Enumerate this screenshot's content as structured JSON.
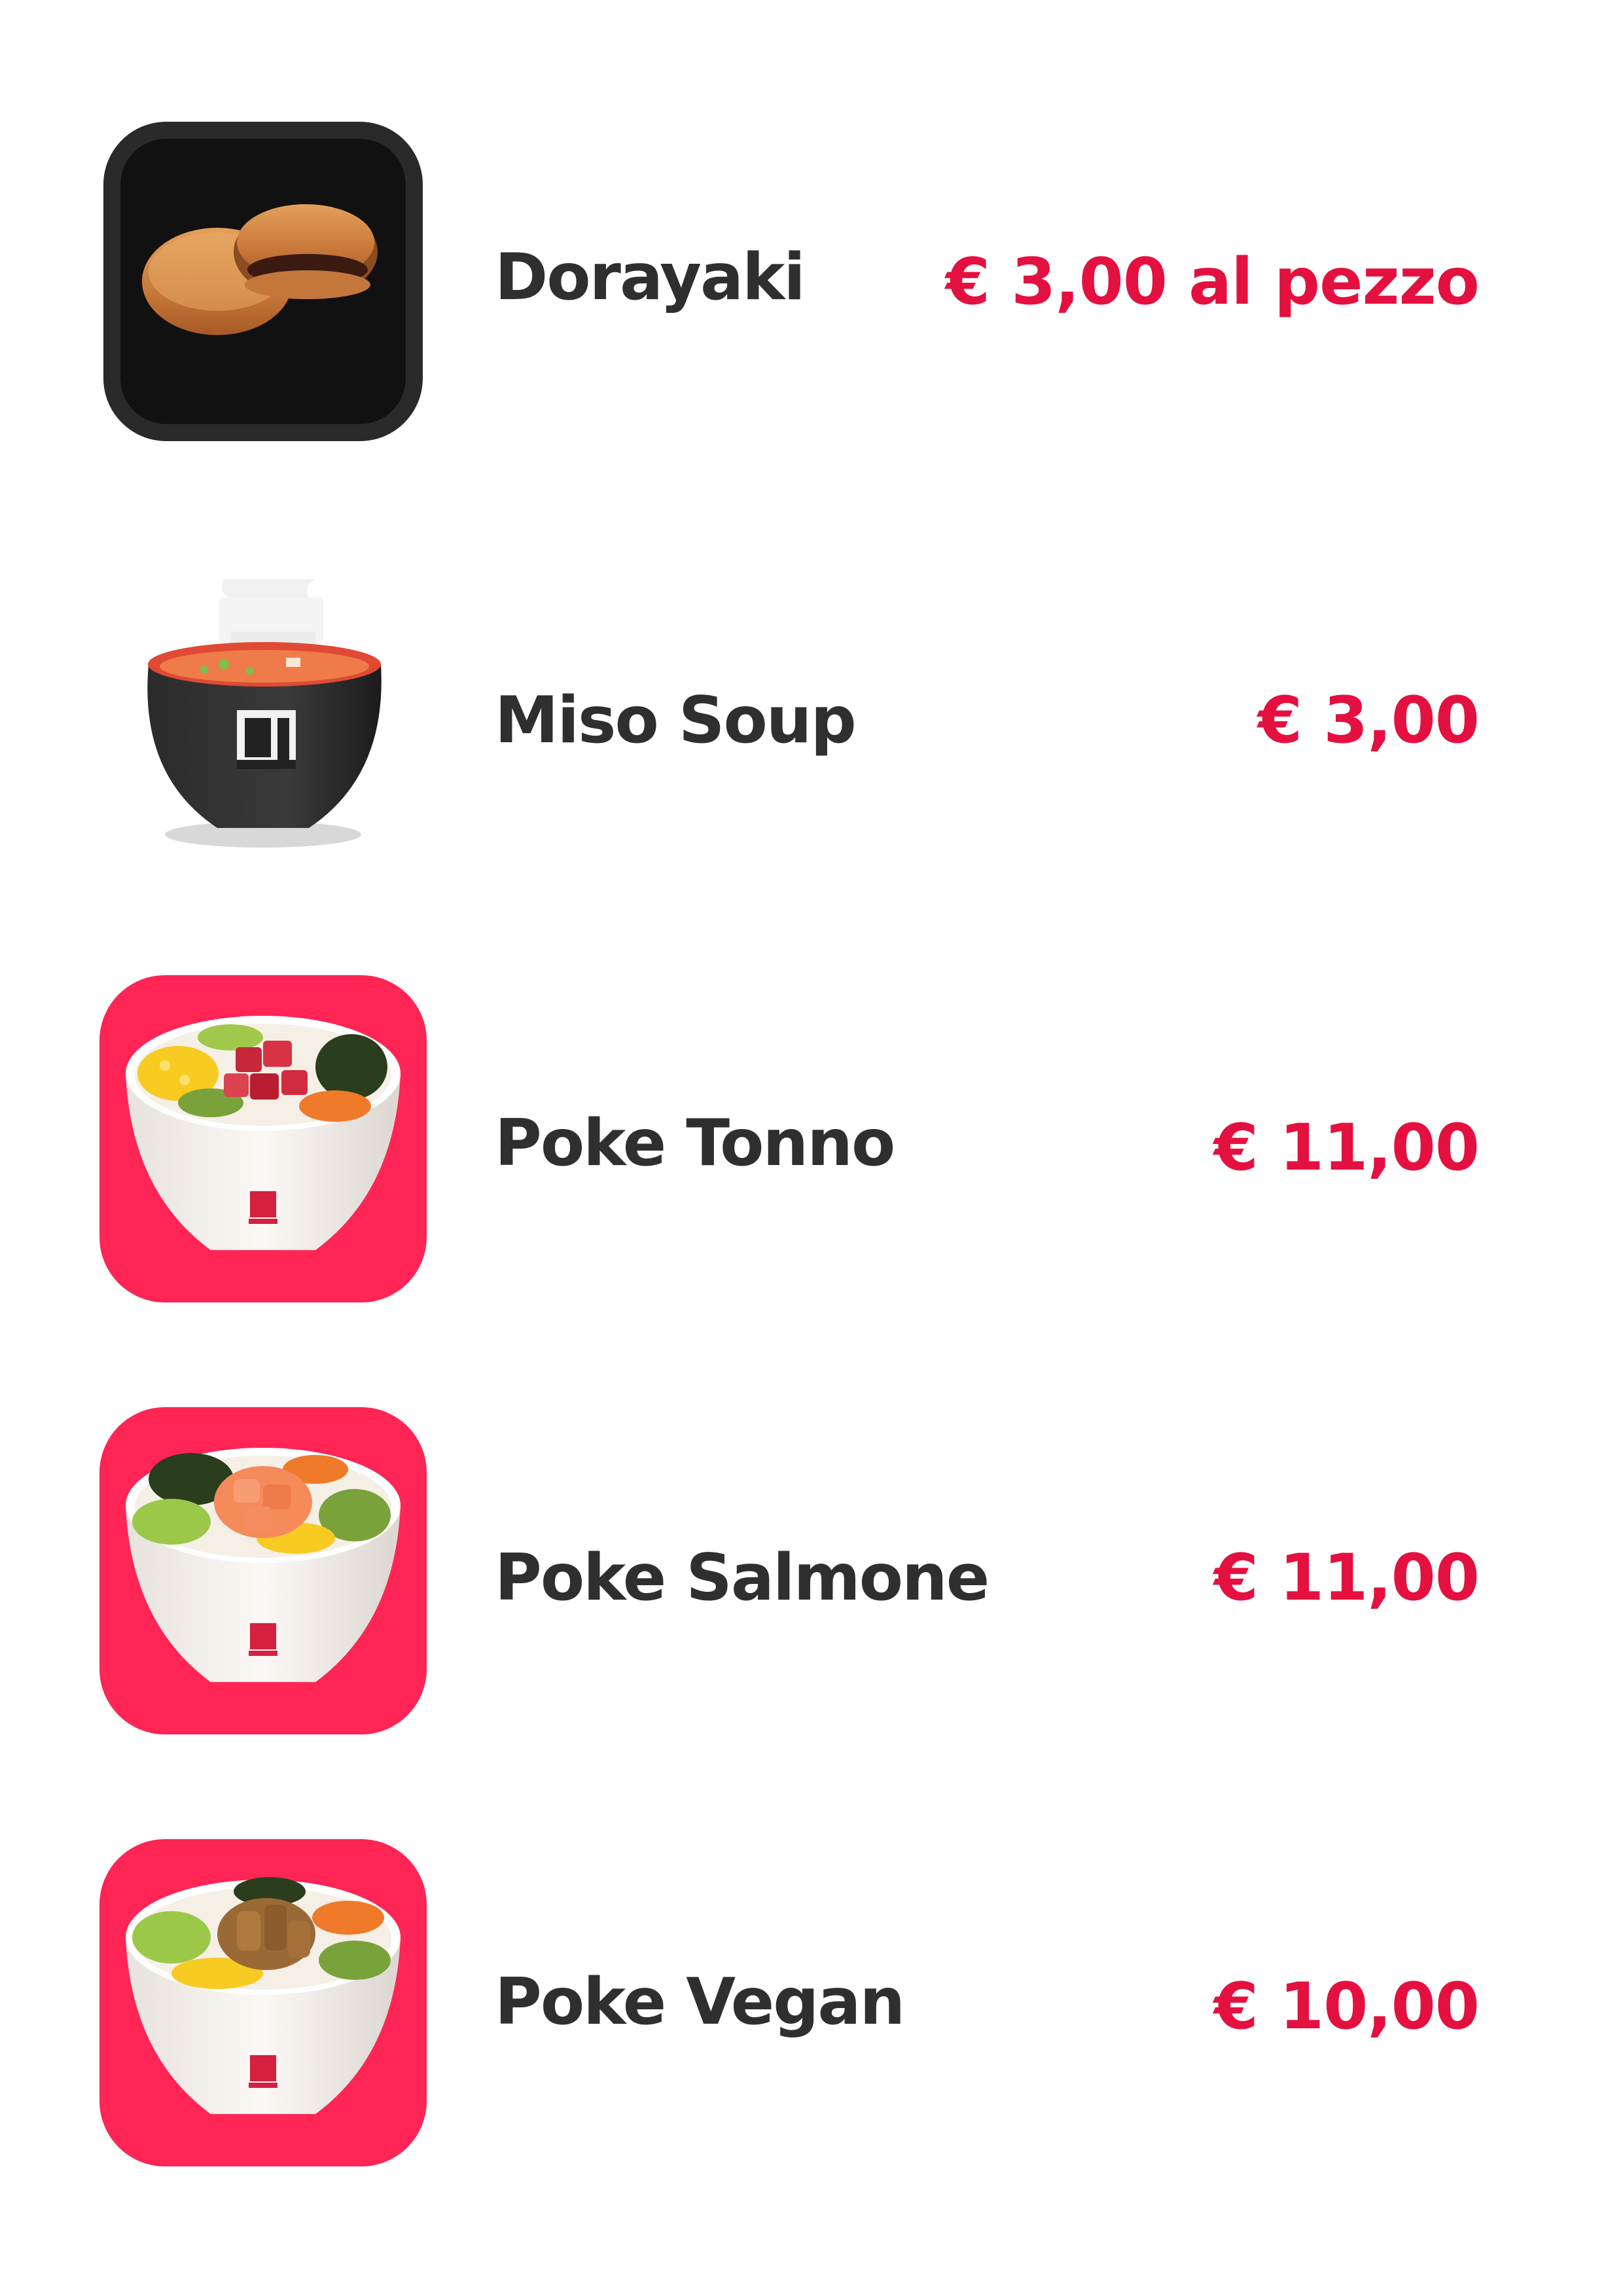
{
  "colors": {
    "accent": "#e4103f",
    "tile_pink": "#ff2554",
    "tile_dark": "#222222",
    "text": "#2f2f2f"
  },
  "items": [
    {
      "name": "Dorayaki",
      "price": "€ 3,00 al pezzo",
      "icon": "dorayaki-icon"
    },
    {
      "name": "Miso Soup",
      "price": "€ 3,00",
      "icon": "miso-soup-icon"
    },
    {
      "name": "Poke Tonno",
      "price": "€ 11,00",
      "icon": "poke-tonno-icon"
    },
    {
      "name": "Poke Salmone",
      "price": "€ 11,00",
      "icon": "poke-salmone-icon"
    },
    {
      "name": "Poke Vegan",
      "price": "€ 10,00",
      "icon": "poke-vegan-icon"
    }
  ]
}
